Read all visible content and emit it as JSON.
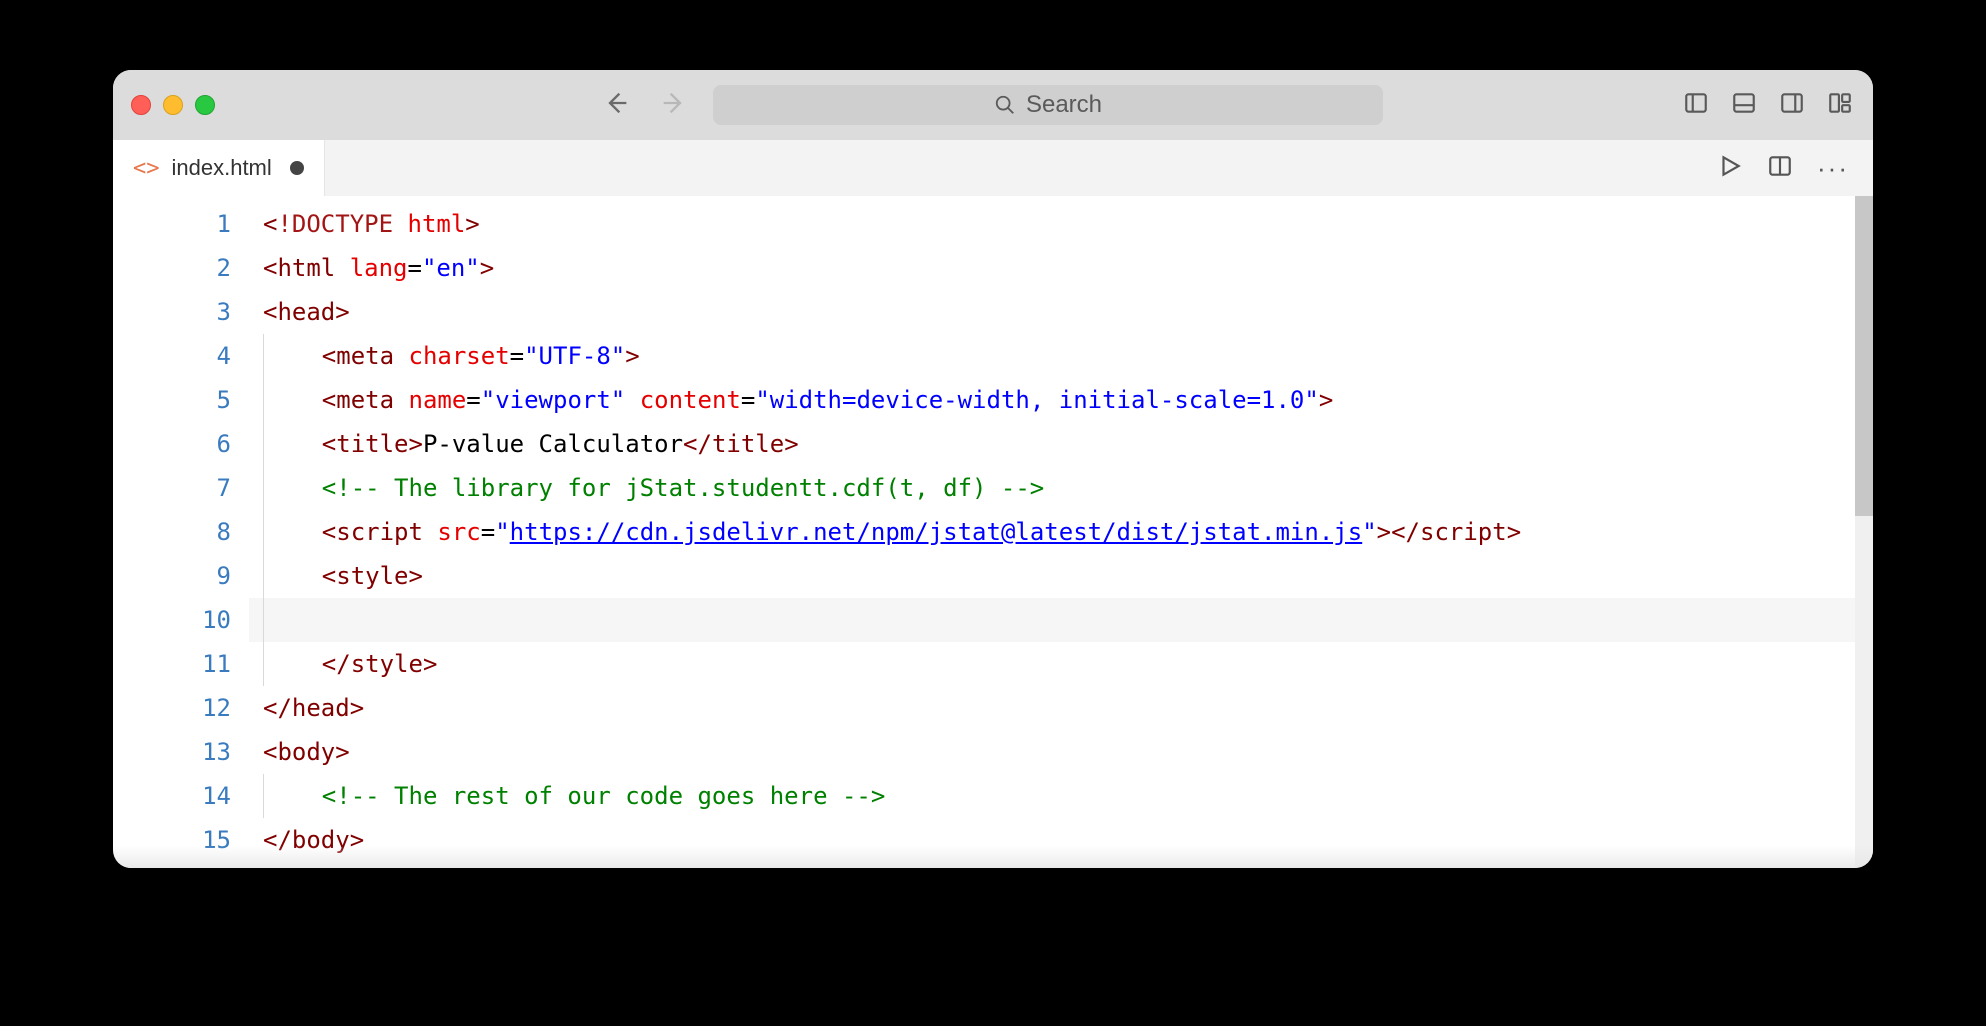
{
  "window": {
    "search_placeholder": "Search"
  },
  "tab": {
    "icon_label": "<>",
    "filename": "index.html",
    "modified": true
  },
  "editor": {
    "line_count": 15,
    "highlighted_line": 10,
    "lines": [
      {
        "n": 1,
        "indent": 0,
        "tokens": [
          {
            "c": "t-punc",
            "t": "<"
          },
          {
            "c": "t-doct",
            "t": "!DOCTYPE "
          },
          {
            "c": "t-attr",
            "t": "html"
          },
          {
            "c": "t-punc",
            "t": ">"
          }
        ]
      },
      {
        "n": 2,
        "indent": 0,
        "tokens": [
          {
            "c": "t-punc",
            "t": "<"
          },
          {
            "c": "t-tag",
            "t": "html "
          },
          {
            "c": "t-attr",
            "t": "lang"
          },
          {
            "c": "t-txt",
            "t": "="
          },
          {
            "c": "t-str",
            "t": "\"en\""
          },
          {
            "c": "t-punc",
            "t": ">"
          }
        ]
      },
      {
        "n": 3,
        "indent": 0,
        "tokens": [
          {
            "c": "t-punc",
            "t": "<"
          },
          {
            "c": "t-tag",
            "t": "head"
          },
          {
            "c": "t-punc",
            "t": ">"
          }
        ]
      },
      {
        "n": 4,
        "indent": 1,
        "tokens": [
          {
            "c": "t-punc",
            "t": "<"
          },
          {
            "c": "t-tag",
            "t": "meta "
          },
          {
            "c": "t-attr",
            "t": "charset"
          },
          {
            "c": "t-txt",
            "t": "="
          },
          {
            "c": "t-str",
            "t": "\"UTF-8\""
          },
          {
            "c": "t-punc",
            "t": ">"
          }
        ]
      },
      {
        "n": 5,
        "indent": 1,
        "tokens": [
          {
            "c": "t-punc",
            "t": "<"
          },
          {
            "c": "t-tag",
            "t": "meta "
          },
          {
            "c": "t-attr",
            "t": "name"
          },
          {
            "c": "t-txt",
            "t": "="
          },
          {
            "c": "t-str",
            "t": "\"viewport\" "
          },
          {
            "c": "t-attr",
            "t": "content"
          },
          {
            "c": "t-txt",
            "t": "="
          },
          {
            "c": "t-str",
            "t": "\"width=device-width, initial-scale=1.0\""
          },
          {
            "c": "t-punc",
            "t": ">"
          }
        ]
      },
      {
        "n": 6,
        "indent": 1,
        "tokens": [
          {
            "c": "t-punc",
            "t": "<"
          },
          {
            "c": "t-tag",
            "t": "title"
          },
          {
            "c": "t-punc",
            "t": ">"
          },
          {
            "c": "t-txt",
            "t": "P-value Calculator"
          },
          {
            "c": "t-punc",
            "t": "</"
          },
          {
            "c": "t-tag",
            "t": "title"
          },
          {
            "c": "t-punc",
            "t": ">"
          }
        ]
      },
      {
        "n": 7,
        "indent": 1,
        "tokens": [
          {
            "c": "t-cmt",
            "t": "<!-- The library for jStat.studentt.cdf(t, df) -->"
          }
        ]
      },
      {
        "n": 8,
        "indent": 1,
        "tokens": [
          {
            "c": "t-punc",
            "t": "<"
          },
          {
            "c": "t-tag",
            "t": "script "
          },
          {
            "c": "t-attr",
            "t": "src"
          },
          {
            "c": "t-txt",
            "t": "="
          },
          {
            "c": "t-str",
            "t": "\""
          },
          {
            "c": "t-link",
            "t": "https://cdn.jsdelivr.net/npm/jstat@latest/dist/jstat.min.js"
          },
          {
            "c": "t-str",
            "t": "\""
          },
          {
            "c": "t-punc",
            "t": "></"
          },
          {
            "c": "t-tag",
            "t": "script"
          },
          {
            "c": "t-punc",
            "t": ">"
          }
        ]
      },
      {
        "n": 9,
        "indent": 1,
        "tokens": [
          {
            "c": "t-punc",
            "t": "<"
          },
          {
            "c": "t-tag",
            "t": "style"
          },
          {
            "c": "t-punc",
            "t": ">"
          }
        ]
      },
      {
        "n": 10,
        "indent": 1,
        "tokens": []
      },
      {
        "n": 11,
        "indent": 1,
        "tokens": [
          {
            "c": "t-punc",
            "t": "</"
          },
          {
            "c": "t-tag",
            "t": "style"
          },
          {
            "c": "t-punc",
            "t": ">"
          }
        ]
      },
      {
        "n": 12,
        "indent": 0,
        "tokens": [
          {
            "c": "t-punc",
            "t": "</"
          },
          {
            "c": "t-tag",
            "t": "head"
          },
          {
            "c": "t-punc",
            "t": ">"
          }
        ]
      },
      {
        "n": 13,
        "indent": 0,
        "tokens": [
          {
            "c": "t-punc",
            "t": "<"
          },
          {
            "c": "t-tag",
            "t": "body"
          },
          {
            "c": "t-punc",
            "t": ">"
          }
        ]
      },
      {
        "n": 14,
        "indent": 1,
        "tokens": [
          {
            "c": "t-cmt",
            "t": "<!-- The rest of our code goes here -->"
          }
        ]
      },
      {
        "n": 15,
        "indent": 0,
        "tokens": [
          {
            "c": "t-punc",
            "t": "</"
          },
          {
            "c": "t-tag",
            "t": "body"
          },
          {
            "c": "t-punc",
            "t": ">"
          }
        ]
      }
    ]
  }
}
